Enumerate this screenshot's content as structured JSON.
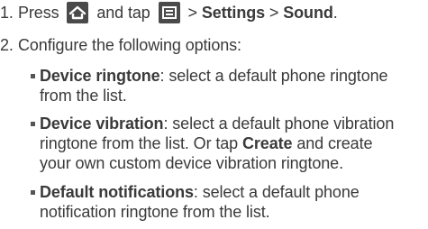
{
  "steps": [
    {
      "num": "1.",
      "press": "Press",
      "and_tap": "and tap",
      "home_icon": "home-icon",
      "menu_icon": "menu-icon",
      "sep1": " > ",
      "path1": "Settings",
      "sep2": " > ",
      "path2": "Sound",
      "end": "."
    },
    {
      "num": "2.",
      "text": "Configure the following options:"
    }
  ],
  "options": [
    {
      "title": "Device ringtone",
      "line1": ": select a default phone ringtone",
      "line2": "from the list."
    },
    {
      "title": "Device vibration",
      "line1": ": select a default phone vibration",
      "line2a": "ringtone from the list. Or tap ",
      "create": "Create",
      "line2b": " and create",
      "line3": "your own custom device vibration ringtone."
    },
    {
      "title": "Default notifications",
      "line1": ": select a default phone",
      "line2": "notification ringtone from the list."
    }
  ]
}
